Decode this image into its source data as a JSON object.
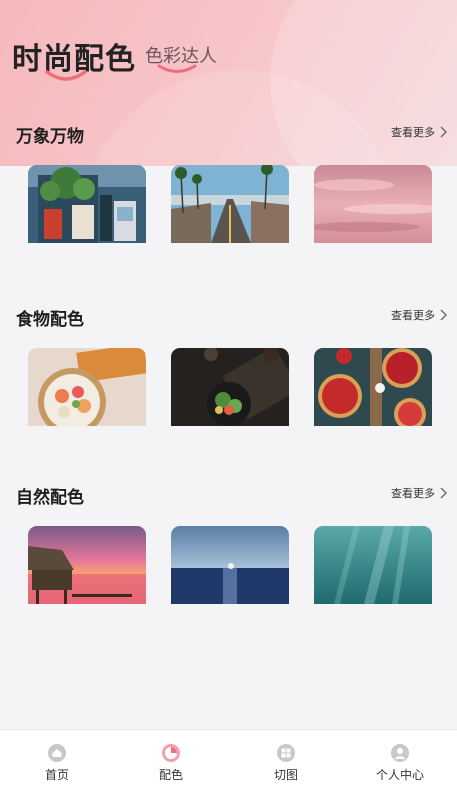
{
  "header": {
    "tab_active": "时尚配色",
    "tab_inactive": "色彩达人"
  },
  "sections": [
    {
      "title": "万象万物",
      "more_label": "查看更多",
      "images": [
        "storefront-photo",
        "palm-street-photo",
        "pink-sky-photo"
      ]
    },
    {
      "title": "食物配色",
      "more_label": "查看更多",
      "images": [
        "sushi-photo",
        "salad-photo",
        "strawberry-tart-photo"
      ]
    },
    {
      "title": "自然配色",
      "more_label": "查看更多",
      "images": [
        "beach-hut-sunset-photo",
        "ocean-moon-photo",
        "underwater-photo"
      ]
    }
  ],
  "tabbar": {
    "items": [
      {
        "label": "首页",
        "icon": "home-icon"
      },
      {
        "label": "配色",
        "icon": "palette-icon"
      },
      {
        "label": "切图",
        "icon": "grid-icon"
      },
      {
        "label": "个人中心",
        "icon": "user-icon"
      }
    ]
  },
  "colors": {
    "header_pink": "#f6b9bd",
    "accent_pink": "#ee6f7c",
    "background": "#f4f4f6"
  }
}
